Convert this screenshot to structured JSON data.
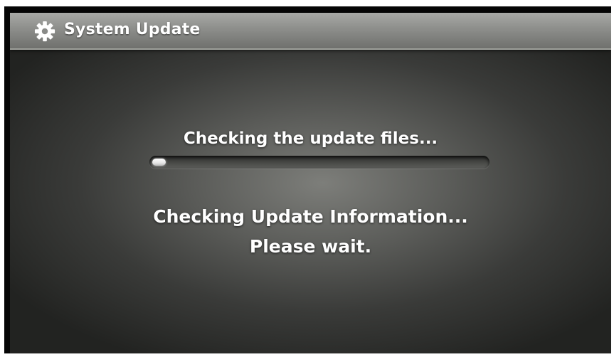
{
  "header": {
    "title": "System Update",
    "icon": "gear-icon"
  },
  "progress": {
    "label": "Checking the update files...",
    "fraction": 0.04
  },
  "message": {
    "line1": "Checking Update Information...",
    "line2": "Please wait."
  },
  "colors": {
    "title_bar": "#8d8e8b",
    "background_center": "#7d7e7a",
    "background_edge": "#222321",
    "text": "#ffffff"
  }
}
